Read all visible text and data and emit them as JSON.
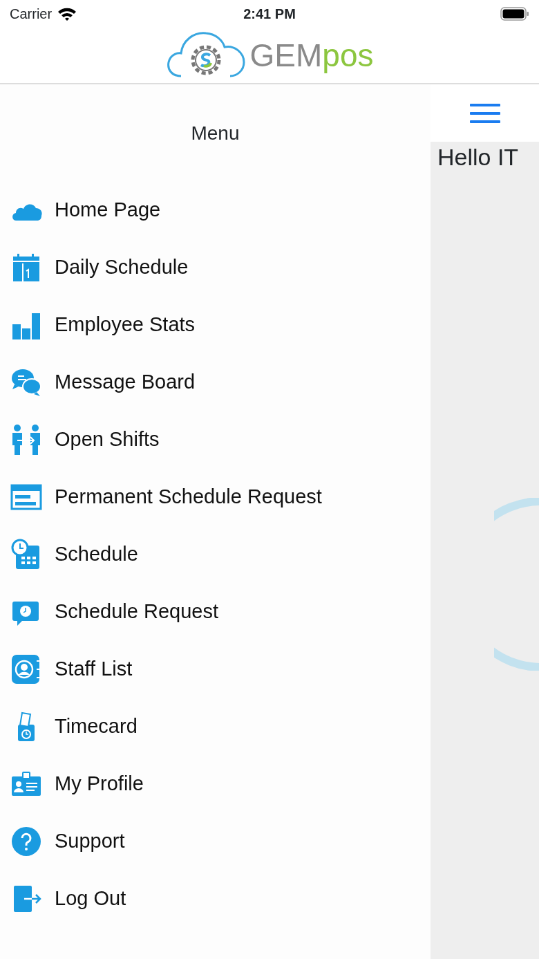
{
  "status_bar": {
    "carrier": "Carrier",
    "time": "2:41 PM"
  },
  "header": {
    "logo_text_1": "GEM",
    "logo_text_2": "pos"
  },
  "menu": {
    "title": "Menu",
    "items": [
      {
        "label": "Home Page"
      },
      {
        "label": "Daily Schedule"
      },
      {
        "label": "Employee Stats"
      },
      {
        "label": "Message Board"
      },
      {
        "label": "Open Shifts"
      },
      {
        "label": "Permanent Schedule Request"
      },
      {
        "label": "Schedule"
      },
      {
        "label": "Schedule Request"
      },
      {
        "label": "Staff List"
      },
      {
        "label": "Timecard"
      },
      {
        "label": "My Profile"
      },
      {
        "label": "Support"
      },
      {
        "label": "Log Out"
      }
    ]
  },
  "content": {
    "greeting": "Hello IT"
  }
}
